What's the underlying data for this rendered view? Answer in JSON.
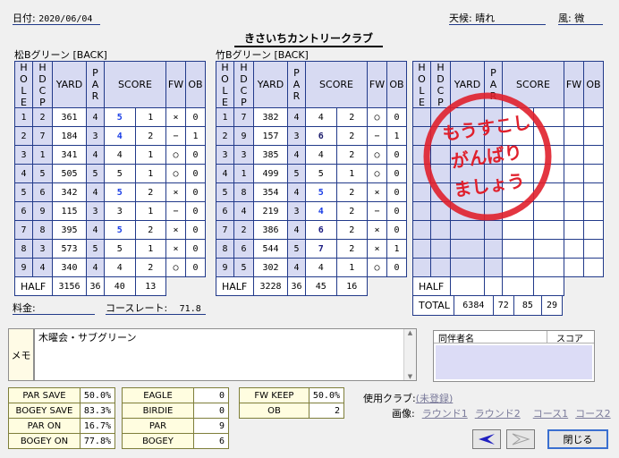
{
  "header": {
    "date_label": "日付:",
    "date_value": "2020/06/04",
    "weather_label": "天候:",
    "weather_value": "晴れ",
    "wind_label": "風:",
    "wind_value": "微",
    "club_name": "きさいちカントリークラブ"
  },
  "columns": {
    "hole": "HOLE",
    "hdcp": "HDCP",
    "yard": "YARD",
    "par": "PAR",
    "score": "SCORE",
    "fw": "FW",
    "ob": "OB"
  },
  "card1": {
    "title": "松Bグリーン [BACK]",
    "rows": [
      [
        "1",
        "2",
        "361",
        "4",
        "5",
        "1",
        "×",
        "0"
      ],
      [
        "2",
        "7",
        "184",
        "3",
        "4",
        "2",
        "−",
        "1"
      ],
      [
        "3",
        "1",
        "341",
        "4",
        "4",
        "1",
        "○",
        "0"
      ],
      [
        "4",
        "5",
        "505",
        "5",
        "5",
        "1",
        "○",
        "0"
      ],
      [
        "5",
        "6",
        "342",
        "4",
        "5",
        "2",
        "×",
        "0"
      ],
      [
        "6",
        "9",
        "115",
        "3",
        "3",
        "1",
        "−",
        "0"
      ],
      [
        "7",
        "8",
        "395",
        "4",
        "5",
        "2",
        "×",
        "0"
      ],
      [
        "8",
        "3",
        "573",
        "5",
        "5",
        "1",
        "×",
        "0"
      ],
      [
        "9",
        "4",
        "340",
        "4",
        "4",
        "2",
        "○",
        "0"
      ]
    ],
    "half": {
      "label": "HALF",
      "yard": "3156",
      "par": "36",
      "score": "40",
      "putts": "13"
    }
  },
  "card2": {
    "title": "竹Bグリーン [BACK]",
    "rows": [
      [
        "1",
        "7",
        "382",
        "4",
        "4",
        "2",
        "○",
        "0"
      ],
      [
        "2",
        "9",
        "157",
        "3",
        "6",
        "2",
        "−",
        "1"
      ],
      [
        "3",
        "3",
        "385",
        "4",
        "4",
        "2",
        "○",
        "0"
      ],
      [
        "4",
        "1",
        "499",
        "5",
        "5",
        "1",
        "○",
        "0"
      ],
      [
        "5",
        "8",
        "354",
        "4",
        "5",
        "2",
        "×",
        "0"
      ],
      [
        "6",
        "4",
        "219",
        "3",
        "4",
        "2",
        "−",
        "0"
      ],
      [
        "7",
        "2",
        "386",
        "4",
        "6",
        "2",
        "×",
        "0"
      ],
      [
        "8",
        "6",
        "544",
        "5",
        "7",
        "2",
        "×",
        "1"
      ],
      [
        "9",
        "5",
        "302",
        "4",
        "4",
        "1",
        "○",
        "0"
      ]
    ],
    "half": {
      "label": "HALF",
      "yard": "3228",
      "par": "36",
      "score": "45",
      "putts": "16"
    }
  },
  "card3": {
    "half_label": "HALF",
    "total": {
      "label": "TOTAL",
      "yard": "6384",
      "par": "72",
      "score": "85",
      "putts": "29"
    }
  },
  "stamp": {
    "line1": "もうすこし",
    "line2": "がんばり",
    "line3": "ましょう",
    "color": "#e0202c"
  },
  "fee": {
    "label": "料金:",
    "value": ""
  },
  "course_rate": {
    "label": "コースレート:",
    "value": "71.8"
  },
  "memo": {
    "label": "メモ",
    "value": "木曜会・サブグリーン"
  },
  "companions": {
    "col_name": "同伴者名",
    "col_score": "スコア"
  },
  "stats1": [
    {
      "label": "PAR SAVE",
      "value": "50.0%"
    },
    {
      "label": "BOGEY SAVE",
      "value": "83.3%"
    },
    {
      "label": "PAR ON",
      "value": "16.7%"
    },
    {
      "label": "BOGEY ON",
      "value": "77.8%"
    }
  ],
  "stats2": [
    {
      "label": "EAGLE",
      "value": "0"
    },
    {
      "label": "BIRDIE",
      "value": "0"
    },
    {
      "label": "PAR",
      "value": "9"
    },
    {
      "label": "BOGEY",
      "value": "6"
    }
  ],
  "stats3": [
    {
      "label": "FW KEEP",
      "value": "50.0%"
    },
    {
      "label": "OB",
      "value": "2"
    }
  ],
  "clubs": {
    "label": "使用クラブ:",
    "value": "(未登録)"
  },
  "images": {
    "label": "画像:",
    "links": [
      "ラウンド1",
      "ラウンド2",
      "コース1",
      "コース2"
    ]
  },
  "buttons": {
    "prev_icon": "left-arrow-icon",
    "next_icon": "right-arrow-icon",
    "close": "閉じる"
  },
  "colors": {
    "grid": "#223a8a",
    "band": "#d7daf2",
    "stamp": "#e0202c"
  }
}
